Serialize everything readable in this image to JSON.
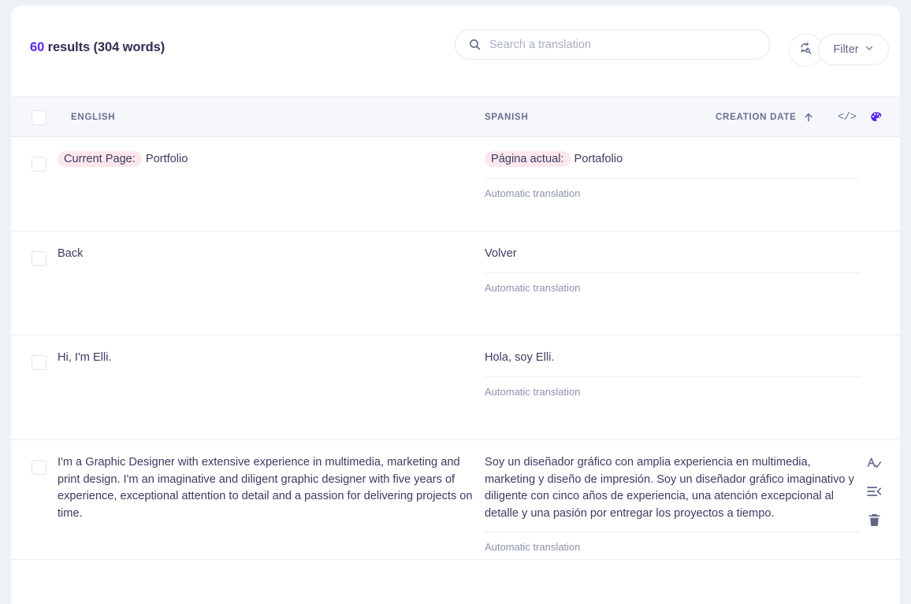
{
  "header": {
    "results_count": "60",
    "results_text": " results (304 words)",
    "search": {
      "placeholder": "Search a translation",
      "value": "",
      "icon": "search-icon"
    },
    "rescan_button": {
      "icon": "search-refresh-icon",
      "label": ""
    },
    "filter_button": {
      "label": "Filter",
      "icon": "chevron-down-icon"
    }
  },
  "table": {
    "columns": {
      "english": "ENGLISH",
      "spanish": "SPANISH",
      "creation_date": "CREATION DATE"
    },
    "sort": {
      "column": "CREATION DATE",
      "direction": "asc",
      "icon": "arrow-up-icon"
    },
    "header_icons": [
      {
        "name": "code-icon",
        "glyph": "</>",
        "color": "#6b7391"
      },
      {
        "name": "palette-icon",
        "glyph": "palette",
        "color": "#5b24f0"
      }
    ],
    "meta_label": "Automatic translation",
    "rows": [
      {
        "source_tag": "Current Page:",
        "source_text": "Portfolio",
        "target_tag": "Página actual:",
        "target_text": "Portafolio",
        "meta": "Automatic translation",
        "actions": []
      },
      {
        "source_tag": "",
        "source_text": "Back",
        "target_tag": "",
        "target_text": "Volver",
        "meta": "Automatic translation",
        "actions": []
      },
      {
        "source_tag": "",
        "source_text": "Hi, I'm Elli.",
        "target_tag": "",
        "target_text": "Hola, soy Elli.",
        "meta": "Automatic translation",
        "actions": []
      },
      {
        "source_tag": "",
        "source_text": "I'm a Graphic Designer with extensive experience in multimedia, marketing and print design. I'm an imaginative and diligent graphic designer with five years of experience, exceptional attention to detail and a passion for delivering projects on time.",
        "target_tag": "",
        "target_text": "Soy un diseñador gráfico con amplia experiencia en multimedia, marketing y diseño de impresión. Soy un diseñador gráfico imaginativo y diligente con cinco años de experiencia, una atención excepcional al detalle y una pasión por entregar los proyectos a tiempo.",
        "meta": "Automatic translation",
        "actions": [
          {
            "name": "spellcheck-icon"
          },
          {
            "name": "shorten-text-icon"
          },
          {
            "name": "delete-icon"
          }
        ]
      }
    ]
  },
  "colors": {
    "accent": "#5b24f0",
    "page_bg": "#eef2f7",
    "card_bg": "#ffffff",
    "header_row_bg": "#f5f7fb",
    "tag_bg": "#fce8ec",
    "text": "#3b3b63",
    "muted": "#8c93ac"
  }
}
